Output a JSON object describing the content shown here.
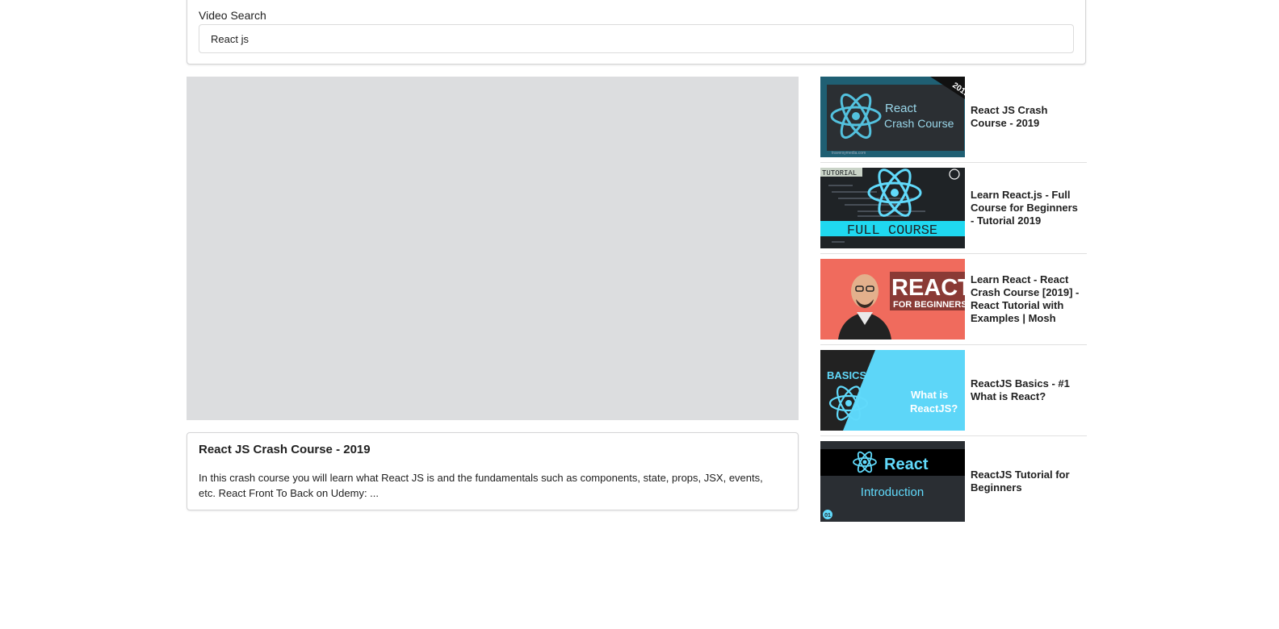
{
  "search": {
    "label": "Video Search",
    "value": "React js"
  },
  "player": {
    "bg_color": "#dcdddf"
  },
  "details": {
    "title": "React JS Crash Course - 2019",
    "description": "In this crash course you will learn what React JS is and the fundamentals such as components, state, props, JSX, events, etc. React Front To Back on Udemy: ..."
  },
  "videos": [
    {
      "title": "React JS Crash Course - 2019",
      "thumb": {
        "icon": "react-logo-icon",
        "badge": "2019",
        "line1": "React",
        "line2": "Crash Course",
        "footer": "traversymedia.com"
      }
    },
    {
      "title": "Learn React.js - Full Course for Beginners - Tutorial 2019",
      "thumb": {
        "icon": "react-logo-icon",
        "tag": "TUTORIAL",
        "banner": "FULL COURSE"
      }
    },
    {
      "title": "Learn React - React Crash Course [2019] - React Tutorial with Examples | Mosh",
      "thumb": {
        "icon": "presenter-photo",
        "line1": "REACT",
        "line2": "FOR BEGINNERS"
      }
    },
    {
      "title": "ReactJS Basics - #1 What is React?",
      "thumb": {
        "icon": "react-logo-icon",
        "line1": "BASICS",
        "line2": "What is",
        "line3": "ReactJS?"
      }
    },
    {
      "title": "ReactJS Tutorial for Beginners",
      "thumb": {
        "icon": "react-logo-icon",
        "line1": "React",
        "line2": "Introduction",
        "badge": "01"
      }
    }
  ]
}
